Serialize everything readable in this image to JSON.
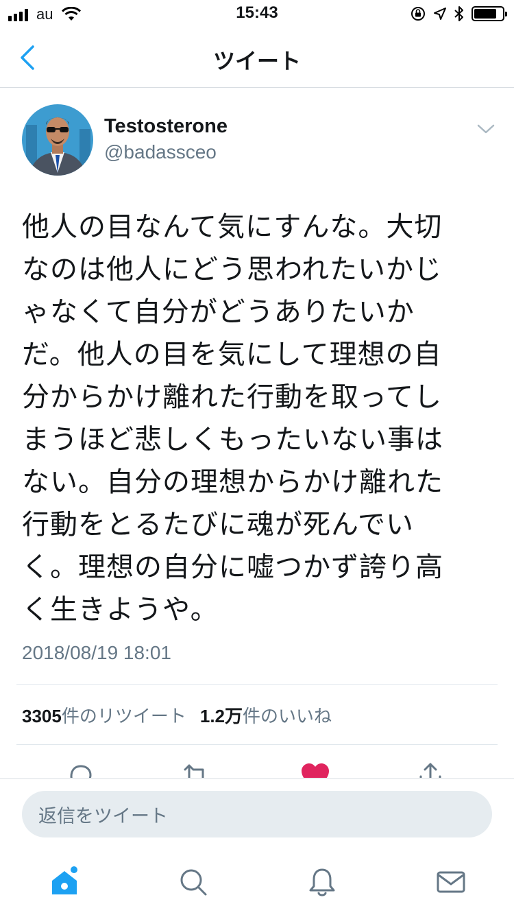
{
  "status_bar": {
    "carrier": "au",
    "time": "15:43"
  },
  "nav": {
    "title": "ツイート"
  },
  "tweet": {
    "display_name": "Testosterone",
    "handle": "@badassceo",
    "text": "他人の目なんて気にすんな。大切\nなのは他人にどう思われたいかじ\nゃなくて自分がどうありたいか\nだ。他人の目を気にして理想の自\n分からかけ離れた行動を取ってし\nまうほど悲しくもったいない事は\nない。自分の理想からかけ離れた\n行動をとるたびに魂が死んでい\nく。理想の自分に嘘つかず誇り高\nく生きようや。",
    "timestamp": "2018/08/19 18:01",
    "retweet_count": "3305",
    "retweet_label": "件のリツイート",
    "like_count": "1.2万",
    "like_label": "件のいいね",
    "liked": true
  },
  "composer": {
    "placeholder": "返信をツイート"
  },
  "tab_bar": {
    "items": [
      "home-icon",
      "search-icon",
      "notifications-icon",
      "messages-icon"
    ],
    "home_has_badge": true
  },
  "colors": {
    "accent": "#1da1f2",
    "like": "#e0245e",
    "secondary_text": "#657786",
    "divider": "#e1e8ed"
  }
}
